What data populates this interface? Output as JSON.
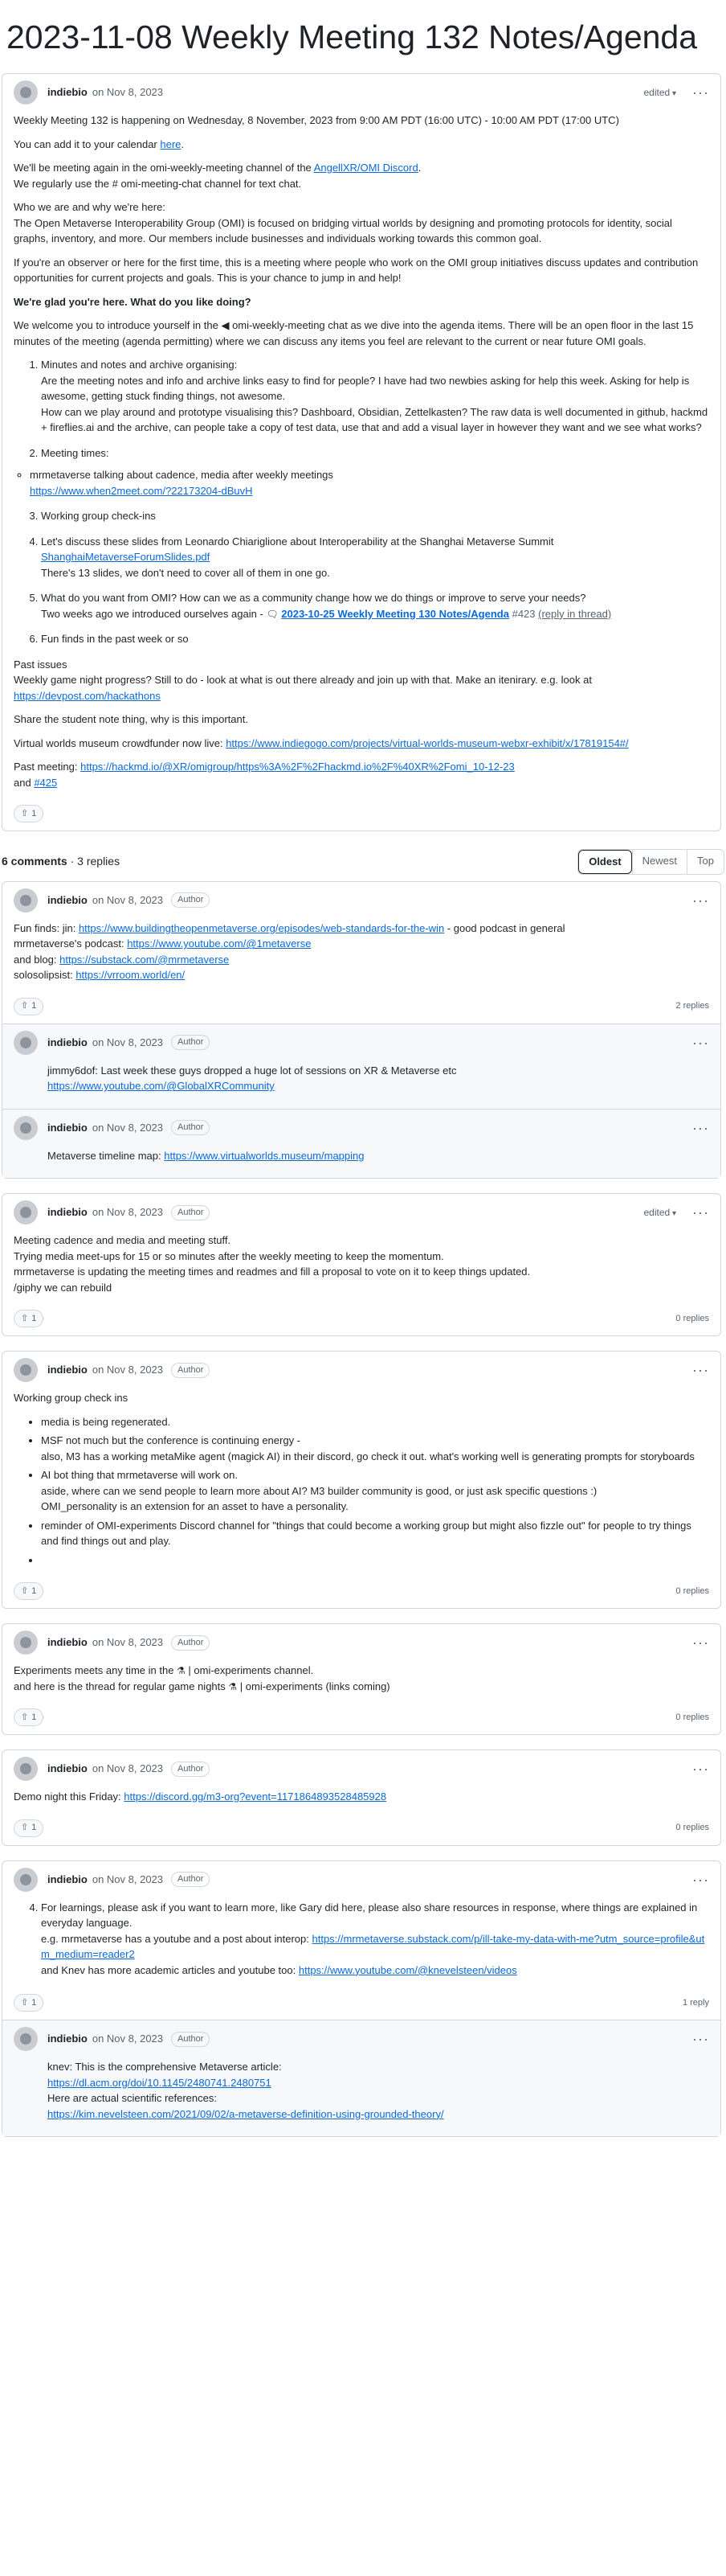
{
  "page": {
    "title": "2023-11-08 Weekly Meeting 132 Notes/Agenda"
  },
  "op": {
    "author": "indiebio",
    "date": "on Nov 8, 2023",
    "edited": "edited",
    "p1": "Weekly Meeting 132 is happening on Wednesday, 8 November, 2023 from 9:00 AM PDT (16:00 UTC) - 10:00 AM PDT (17:00 UTC)",
    "p2_pre": "You can add it to your calendar ",
    "p2_link": "here",
    "p2_post": ".",
    "p3_pre": "We'll be meeting again in the omi-weekly-meeting channel of the ",
    "p3_link": "AngellXR/OMI Discord",
    "p3_post": ".",
    "p3_line2": "We regularly use the # omi-meeting-chat channel for text chat.",
    "p4_line1": "Who we are and why we're here:",
    "p4_line2": "The Open Metaverse Interoperability Group (OMI) is focused on bridging virtual worlds by designing and promoting protocols for identity, social graphs, inventory, and more. Our members include businesses and individuals working towards this common goal.",
    "p5": "If you're an observer or here for the first time, this is a meeting where people who work on the OMI group initiatives discuss updates and contribution opportunities for current projects and goals. This is your chance to jump in and help!",
    "p6": "We're glad you're here. What do you like doing?",
    "p7_pre": "We welcome you to introduce yourself in the ",
    "p7_icon": "◀",
    "p7_post": " omi-weekly-meeting chat as we dive into the agenda items. There will be an open floor in the last 15 minutes of the meeting (agenda permitting) where we can discuss any items you feel are relevant to the current or near future OMI goals.",
    "item1_title": "Minutes and notes and archive organising:",
    "item1_body": "Are the meeting notes and info and archive links easy to find for people? I have had two newbies asking for help this week. Asking for help is awesome, getting stuck finding things, not awesome.",
    "item1_body2": "How can we play around and prototype visualising this? Dashboard, Obsidian, Zettelkasten? The raw data is well documented in github, hackmd + fireflies.ai and the archive, can people take a copy of test data, use that and add a visual layer in however they want and we see what works?",
    "item2_title": "Meeting times:",
    "item2_bullet": "mrmetaverse talking about cadence, media after weekly meetings",
    "item2_link": "https://www.when2meet.com/?22173204-dBuvH",
    "item3_title": "Working group check-ins",
    "item4_title": "Let's discuss these slides from Leonardo Chiariglione about Interoperability at the Shanghai Metaverse Summit",
    "item4_link": "ShanghaiMetaverseForumSlides.pdf",
    "item4_note": "There's 13 slides, we don't need to cover all of them in one go.",
    "item5_title": "What do you want from OMI? How can we as a community change how we do things or improve to serve your needs?",
    "item5_pre": "Two weeks ago we introduced ourselves again - ",
    "item5_icon": "🗨",
    "item5_link": "2023-10-25 Weekly Meeting 130 Notes/Agenda",
    "item5_num": "#423",
    "item5_post": "(reply in thread)",
    "item6_title": "Fun finds in the past week or so",
    "past_title": "Past issues",
    "past_body_pre": "Weekly game night progress? Still to do - look at what is out there already and join up with that. Make an itenirary. e.g. look at ",
    "past_link": "https://devpost.com/hackathons",
    "student": "Share the student note thing, why is this important.",
    "museum_pre": "Virtual worlds museum crowdfunder now live: ",
    "museum_link": "https://www.indiegogo.com/projects/virtual-worlds-museum-webxr-exhibit/x/17819154#/",
    "pastmeet_pre": "Past meeting: ",
    "pastmeet_link": "https://hackmd.io/@XR/omigroup/https%3A%2F%2Fhackmd.io%2F%40XR%2Fomi_10-12-23",
    "pastmeet_and": "and ",
    "pastmeet_num": "#425",
    "upvotes": "1"
  },
  "sort": {
    "count": "6 comments",
    "sep": " · ",
    "replies": "3 replies",
    "oldest": "Oldest",
    "newest": "Newest",
    "top": "Top"
  },
  "c1": {
    "author": "indiebio",
    "date": "on Nov 8, 2023",
    "badge": "Author",
    "l1_pre": "Fun finds: jin: ",
    "l1_link": "https://www.buildingtheopenmetaverse.org/episodes/web-standards-for-the-win",
    "l1_post": " - good podcast in general",
    "l2_pre": "mrmetaverse's podcast: ",
    "l2_link": "https://www.youtube.com/@1metaverse",
    "l3_pre": "and blog: ",
    "l3_link": "https://substack.com/@mrmetaverse",
    "l4_pre": "solosolipsist: ",
    "l4_link": "https://vrroom.world/en/",
    "upvotes": "1",
    "replies": "2 replies",
    "r1": {
      "author": "indiebio",
      "date": "on Nov 8, 2023",
      "badge": "Author",
      "text": "jimmy6dof: Last week these guys dropped a huge lot of sessions on XR & Metaverse etc",
      "link": "https://www.youtube.com/@GlobalXRCommunity"
    },
    "r2": {
      "author": "indiebio",
      "date": "on Nov 8, 2023",
      "badge": "Author",
      "text_pre": "Metaverse timeline map: ",
      "link": "https://www.virtualworlds.museum/mapping"
    }
  },
  "c2": {
    "author": "indiebio",
    "date": "on Nov 8, 2023",
    "badge": "Author",
    "edited": "edited",
    "l1": "Meeting cadence and media and meeting stuff.",
    "l2": "Trying media meet-ups for 15 or so minutes after the weekly meeting to keep the momentum.",
    "l3": "mrmetaverse is updating the meeting times and readmes and fill a proposal to vote on it to keep things updated.",
    "l4": "/giphy we can rebuild",
    "upvotes": "1",
    "replies": "0 replies"
  },
  "c3": {
    "author": "indiebio",
    "date": "on Nov 8, 2023",
    "badge": "Author",
    "title": "Working group check ins",
    "b1": "media is being regenerated.",
    "b2": "MSF not much but the conference is continuing energy -",
    "b2b": "also, M3 has a working metaMike agent (magick AI) in their discord, go check it out. what's working well is generating prompts for storyboards",
    "b3": "AI bot thing that mrmetaverse will work on.",
    "b3b": "aside, where can we send people to learn more about AI? M3 builder community is good, or just ask specific questions :)",
    "b3c": "OMI_personality is an extension for an asset to have a personality.",
    "b4": "reminder of OMI-experiments Discord channel for \"things that could become a working group but might also fizzle out\" for people to try things and find things out and play.",
    "b5": "",
    "upvotes": "1",
    "replies": "0 replies"
  },
  "c4": {
    "author": "indiebio",
    "date": "on Nov 8, 2023",
    "badge": "Author",
    "l1_pre": "Experiments meets any time in the ",
    "l1_icon": "⚗",
    "l1_post": " | omi-experiments channel.",
    "l2_pre": "and here is the thread for regular game nights ",
    "l2_icon": "⚗",
    "l2_post": " | omi-experiments (links coming)",
    "upvotes": "1",
    "replies": "0 replies"
  },
  "c5": {
    "author": "indiebio",
    "date": "on Nov 8, 2023",
    "badge": "Author",
    "l1_pre": "Demo night this Friday: ",
    "l1_link": "https://discord.gg/m3-org?event=1171864893528485928",
    "upvotes": "1",
    "replies": "0 replies"
  },
  "c6": {
    "author": "indiebio",
    "date": "on Nov 8, 2023",
    "badge": "Author",
    "item": "For learnings, please ask if you want to learn more, like Gary did here, please also share resources in response, where things are explained in everyday language.",
    "l2_pre": "e.g. mrmetaverse has a youtube and a post about interop: ",
    "l2_link": "https://mrmetaverse.substack.com/p/ill-take-my-data-with-me?utm_source=profile&utm_medium=reader2",
    "l3_pre": "and Knev has more academic articles and youtube too: ",
    "l3_link": "https://www.youtube.com/@knevelsteen/videos",
    "upvotes": "1",
    "replies": "1 reply",
    "r1": {
      "author": "indiebio",
      "date": "on Nov 8, 2023",
      "badge": "Author",
      "l1": "knev: This is the comprehensive Metaverse article:",
      "l1_link": "https://dl.acm.org/doi/10.1145/2480741.2480751",
      "l2": "Here are actual scientific references:",
      "l2_link": "https://kim.nevelsteen.com/2021/09/02/a-metaverse-definition-using-grounded-theory/"
    }
  }
}
